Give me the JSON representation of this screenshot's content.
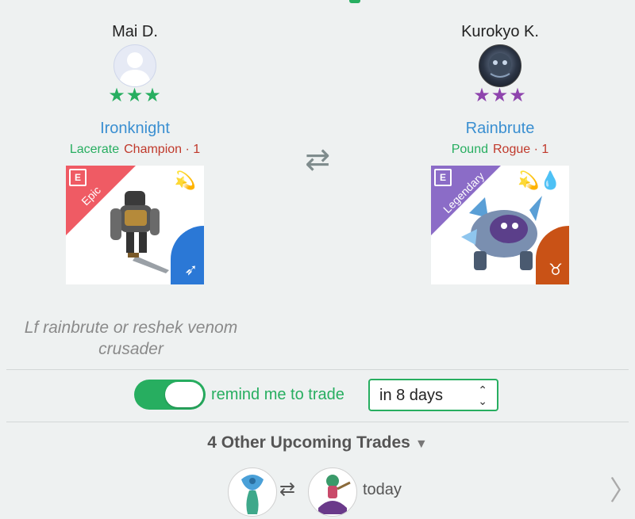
{
  "trade": {
    "left": {
      "player_name": "Mai D.",
      "stars": "★★★",
      "monster_name": "Ironknight",
      "trait": "Lacerate",
      "class_level": "Champion · 1",
      "rarity": "Epic",
      "badge": "E",
      "element_icon": "💫",
      "class_icon": "➶",
      "accent_color": "#27ae60"
    },
    "right": {
      "player_name": "Kurokyo K.",
      "stars": "★★★",
      "monster_name": "Rainbrute",
      "trait": "Pound",
      "class_level": "Rogue · 1",
      "rarity": "Legendary",
      "badge": "E",
      "element_icon": "💫💧",
      "class_icon": "♉",
      "accent_color": "#8e44ad"
    },
    "swap_icon": "⇄",
    "note": "Lf rainbrute or reshek venom crusader"
  },
  "reminder": {
    "label": "remind me to trade",
    "enabled": true,
    "selected_option": "in 8 days"
  },
  "upcoming": {
    "title": "4 Other Upcoming Trades",
    "toggle_icon": "▼",
    "item": {
      "swap_icon": "⇄",
      "when": "today"
    },
    "next_icon": "〉"
  },
  "colors": {
    "accent": "#27ae60",
    "link": "#3a8fd1",
    "epic": "#ef5b64",
    "legendary": "#8b6cc7"
  }
}
